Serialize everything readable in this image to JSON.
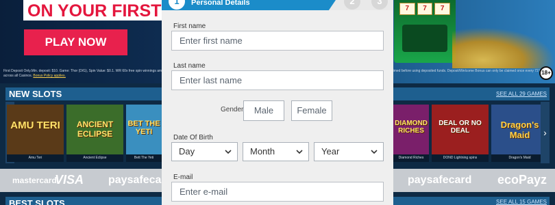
{
  "hero": {
    "headline": "ON YOUR FIRST",
    "play_button": "PLAY NOW",
    "terms_text": "First Deposit Only.Min. deposit: $10. Game: Thor (D/G), Spin Value: $0.1. WR 60x free spin winnings amount (only Slots count) within 30 days. Max bet is 10% (min $0.10) of the free spin winnings and bonus or $5 (lowest amount applies). Bonus must be claimed before using deposited funds. Deposit/Welcome Bonus can only be claimed once every 72 hours across all Casinos.",
    "terms_link": "Bonus Policy applies.",
    "age_badge": "18+",
    "reel_symbols": [
      "7",
      "7",
      "7"
    ]
  },
  "new_slots": {
    "title": "NEW SLOTS",
    "see_all": "SEE ALL 29 GAMES",
    "prev_arrow": "‹",
    "next_arrow": "›",
    "tiles": [
      {
        "art": "AMU TERI",
        "caption": "Amu Teri",
        "color": "#5a3a18"
      },
      {
        "art": "ANCIENT ECLIPSE",
        "caption": "Ancient Eclipse",
        "color": "#3b6d2a"
      },
      {
        "art": "BET THE YETI",
        "caption": "Bett The Yeti",
        "color": "#3a8fbf"
      },
      {
        "art": "DIAMOND RICHES",
        "caption": "Diamond Riches",
        "color": "#7a1f6a"
      },
      {
        "art": "DEAL OR NO DEAL",
        "caption": "DOND Lightning spins",
        "color": "#9b1f1f"
      },
      {
        "art": "Dragon's Maid",
        "caption": "Dragon's Maid",
        "color": "#2b4f8a"
      }
    ]
  },
  "payments": {
    "items": [
      "mastercard",
      "VISA",
      "paysafecard",
      "paysafecard",
      "ecoPayz"
    ]
  },
  "best_slots": {
    "title": "BEST SLOTS",
    "see_all": "SEE ALL 15 GAMES"
  },
  "modal": {
    "steps": [
      {
        "number": "1",
        "title": "Personal Details"
      },
      {
        "number": "2"
      },
      {
        "number": "3"
      }
    ],
    "first_name": {
      "label": "First name",
      "placeholder": "Enter first name",
      "value": ""
    },
    "last_name": {
      "label": "Last name",
      "placeholder": "Enter last name",
      "value": ""
    },
    "gender": {
      "label": "Gender",
      "options": [
        "Male",
        "Female"
      ]
    },
    "dob": {
      "label": "Date Of Birth",
      "day": "Day",
      "month": "Month",
      "year": "Year"
    },
    "email": {
      "label": "E-mail",
      "placeholder": "Enter e-mail",
      "value": ""
    }
  },
  "colors": {
    "accent_blue": "#1b8cc9",
    "cta_red": "#e8214d",
    "section_blue": "#1e5f8f"
  }
}
